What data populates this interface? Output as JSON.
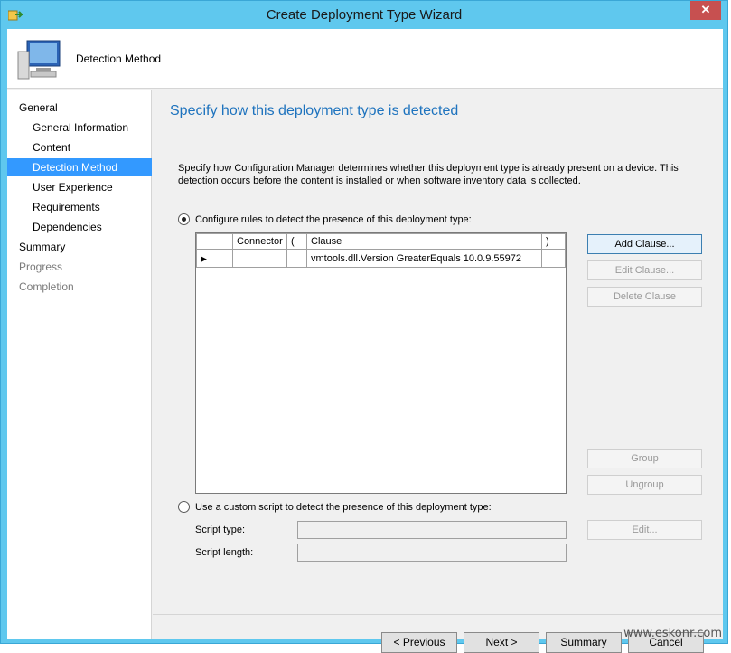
{
  "window": {
    "title": "Create Deployment Type Wizard",
    "close_label": "✕"
  },
  "header": {
    "title": "Detection Method",
    "icon": "computer-monitor-icon"
  },
  "nav": {
    "items": [
      {
        "label": "General"
      },
      {
        "label": "General Information"
      },
      {
        "label": "Content"
      },
      {
        "label": "Detection Method"
      },
      {
        "label": "User Experience"
      },
      {
        "label": "Requirements"
      },
      {
        "label": "Dependencies"
      },
      {
        "label": "Summary"
      },
      {
        "label": "Progress"
      },
      {
        "label": "Completion"
      }
    ]
  },
  "main": {
    "heading": "Specify how this deployment type is detected",
    "description": "Specify how Configuration Manager determines whether this deployment type is already present on a device. This detection occurs before the content is installed or when software inventory data is collected.",
    "option_rules": "Configure rules to detect the presence of this deployment type:",
    "option_script": "Use a custom script to detect the presence of this deployment type:",
    "grid": {
      "headers": [
        "Connector",
        "(",
        "Clause",
        ")"
      ],
      "rows": [
        {
          "connector": "",
          "open": "",
          "clause": "vmtools.dll.Version  GreaterEquals 10.0.9.55972",
          "close": ""
        }
      ]
    },
    "buttons": {
      "add_clause": "Add Clause...",
      "edit_clause": "Edit Clause...",
      "delete_clause": "Delete Clause",
      "group": "Group",
      "ungroup": "Ungroup",
      "edit": "Edit..."
    },
    "script_type_label": "Script type:",
    "script_length_label": "Script length:"
  },
  "footer": {
    "previous": "< Previous",
    "next": "Next >",
    "summary": "Summary",
    "cancel": "Cancel"
  },
  "watermark": "www.eskonr.com"
}
